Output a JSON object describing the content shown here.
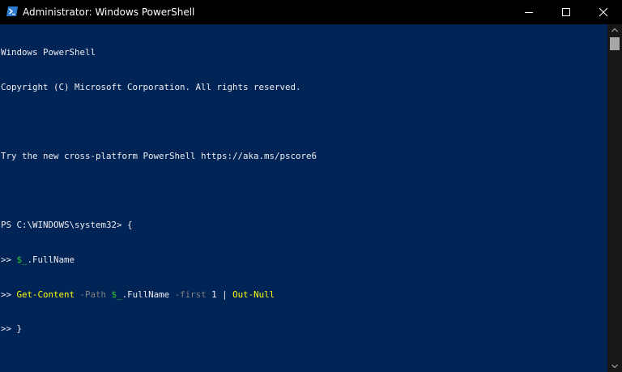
{
  "window": {
    "title": "Administrator: Windows PowerShell",
    "icon": "powershell-icon",
    "controls": [
      "minimize-icon",
      "maximize-icon",
      "close-icon"
    ]
  },
  "console": {
    "banner": "Windows PowerShell",
    "copyright": "Copyright (C) Microsoft Corporation. All rights reserved.",
    "blank_1": "",
    "tip": "Try the new cross-platform PowerShell https://aka.ms/pscore6",
    "blank_2": "",
    "prompt_line": {
      "prompt": "PS C:\\WINDOWS\\system32> ",
      "text": "{"
    },
    "line_2": {
      "prefix": ">> ",
      "var": "$_",
      "rest": ".FullName"
    },
    "line_3": {
      "prefix": ">> ",
      "cmd": "Get-Content",
      "param1": " -Path ",
      "var": "$_",
      "rest1": ".FullName ",
      "param2": "-first",
      "num": " 1 | ",
      "cmd2": "Out-Null"
    },
    "line_4": {
      "prefix": ">> ",
      "text": "}"
    }
  },
  "colors": {
    "background": "#012456",
    "foreground": "#eeedf0",
    "command": "#ffff00",
    "variable": "#32c832",
    "parameter": "#808080",
    "titlebar": "#000000"
  }
}
